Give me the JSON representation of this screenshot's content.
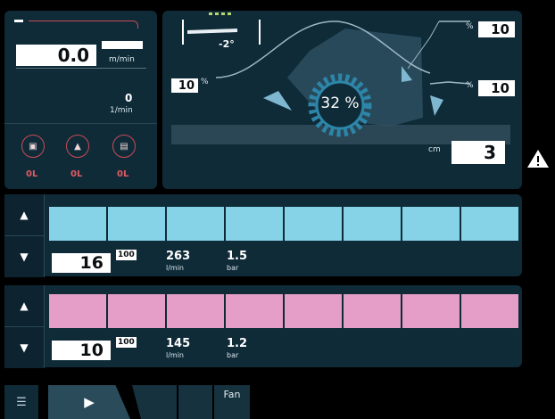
{
  "top_left": {
    "speed_value": "0.0",
    "speed_unit": "m/min",
    "rpm_value": "0",
    "rpm_unit": "1/min",
    "sensors": [
      {
        "icon": "sensor-1-icon",
        "value": "0L"
      },
      {
        "icon": "sensor-2-icon",
        "value": "0L"
      },
      {
        "icon": "sensor-3-icon",
        "value": "0L"
      }
    ]
  },
  "top_right": {
    "tilt_value": "-2°",
    "center_percent": "32 %",
    "left_percent_value": "10",
    "left_percent_unit": "%",
    "right_top_percent_value": "10",
    "right_top_percent_unit": "%",
    "right_mid_percent_value": "10",
    "right_mid_percent_unit": "%",
    "height_unit": "cm",
    "height_value": "3"
  },
  "section_1": {
    "color": "#86d2e6",
    "value": "16",
    "badge": "100",
    "flow_value": "263",
    "flow_unit": "l/min",
    "pressure_value": "1.5",
    "pressure_unit": "bar"
  },
  "section_2": {
    "color": "#e59ec8",
    "value": "10",
    "badge": "100",
    "flow_value": "145",
    "flow_unit": "l/min",
    "pressure_value": "1.2",
    "pressure_unit": "bar"
  },
  "bottom_tabs": {
    "fan_label": "Fan"
  },
  "colors": {
    "panel": "#0f2b38",
    "accent_red": "#c94b55",
    "cyan_cells": "#86d2e6",
    "pink_cells": "#e59ec8"
  }
}
